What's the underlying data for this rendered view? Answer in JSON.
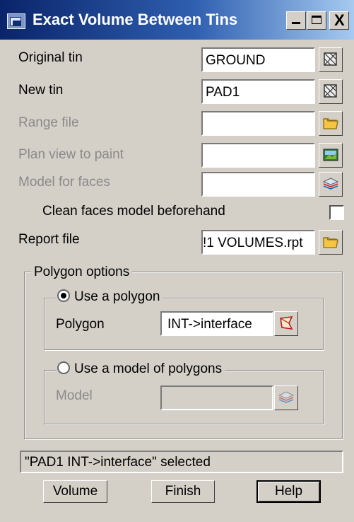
{
  "window": {
    "title": "Exact Volume Between Tins"
  },
  "title_buttons": {
    "minimize": "minimize",
    "maximize": "maximize",
    "close": "X"
  },
  "fields": {
    "original_tin": {
      "label": "Original tin",
      "value": "GROUND"
    },
    "new_tin": {
      "label": "New tin",
      "value": "PAD1"
    },
    "range_file": {
      "label": "Range file",
      "value": ""
    },
    "plan_view": {
      "label": "Plan view to paint",
      "value": ""
    },
    "model_faces": {
      "label": "Model for faces",
      "value": ""
    },
    "clean_faces": {
      "label": "Clean faces model beforehand",
      "checked": false
    },
    "report_file": {
      "label": "Report file",
      "value": "!1 VOLUMES.rpt"
    }
  },
  "polygon_options": {
    "title": "Polygon options",
    "use_polygon": {
      "label": "Use a polygon",
      "selected": true,
      "field_label": "Polygon",
      "value": "INT->interface"
    },
    "use_model": {
      "label": "Use a model of polygons",
      "selected": false,
      "field_label": "Model",
      "value": ""
    }
  },
  "status": "\"PAD1 INT->interface\" selected",
  "buttons": {
    "volume": "Volume",
    "finish": "Finish",
    "help": "Help"
  },
  "icons": {
    "tin_pick": "tin-icon",
    "folder": "folder-icon",
    "plan_view": "plan-view-icon",
    "model": "model-layers-icon",
    "polygon_pick": "polygon-pick-icon"
  }
}
